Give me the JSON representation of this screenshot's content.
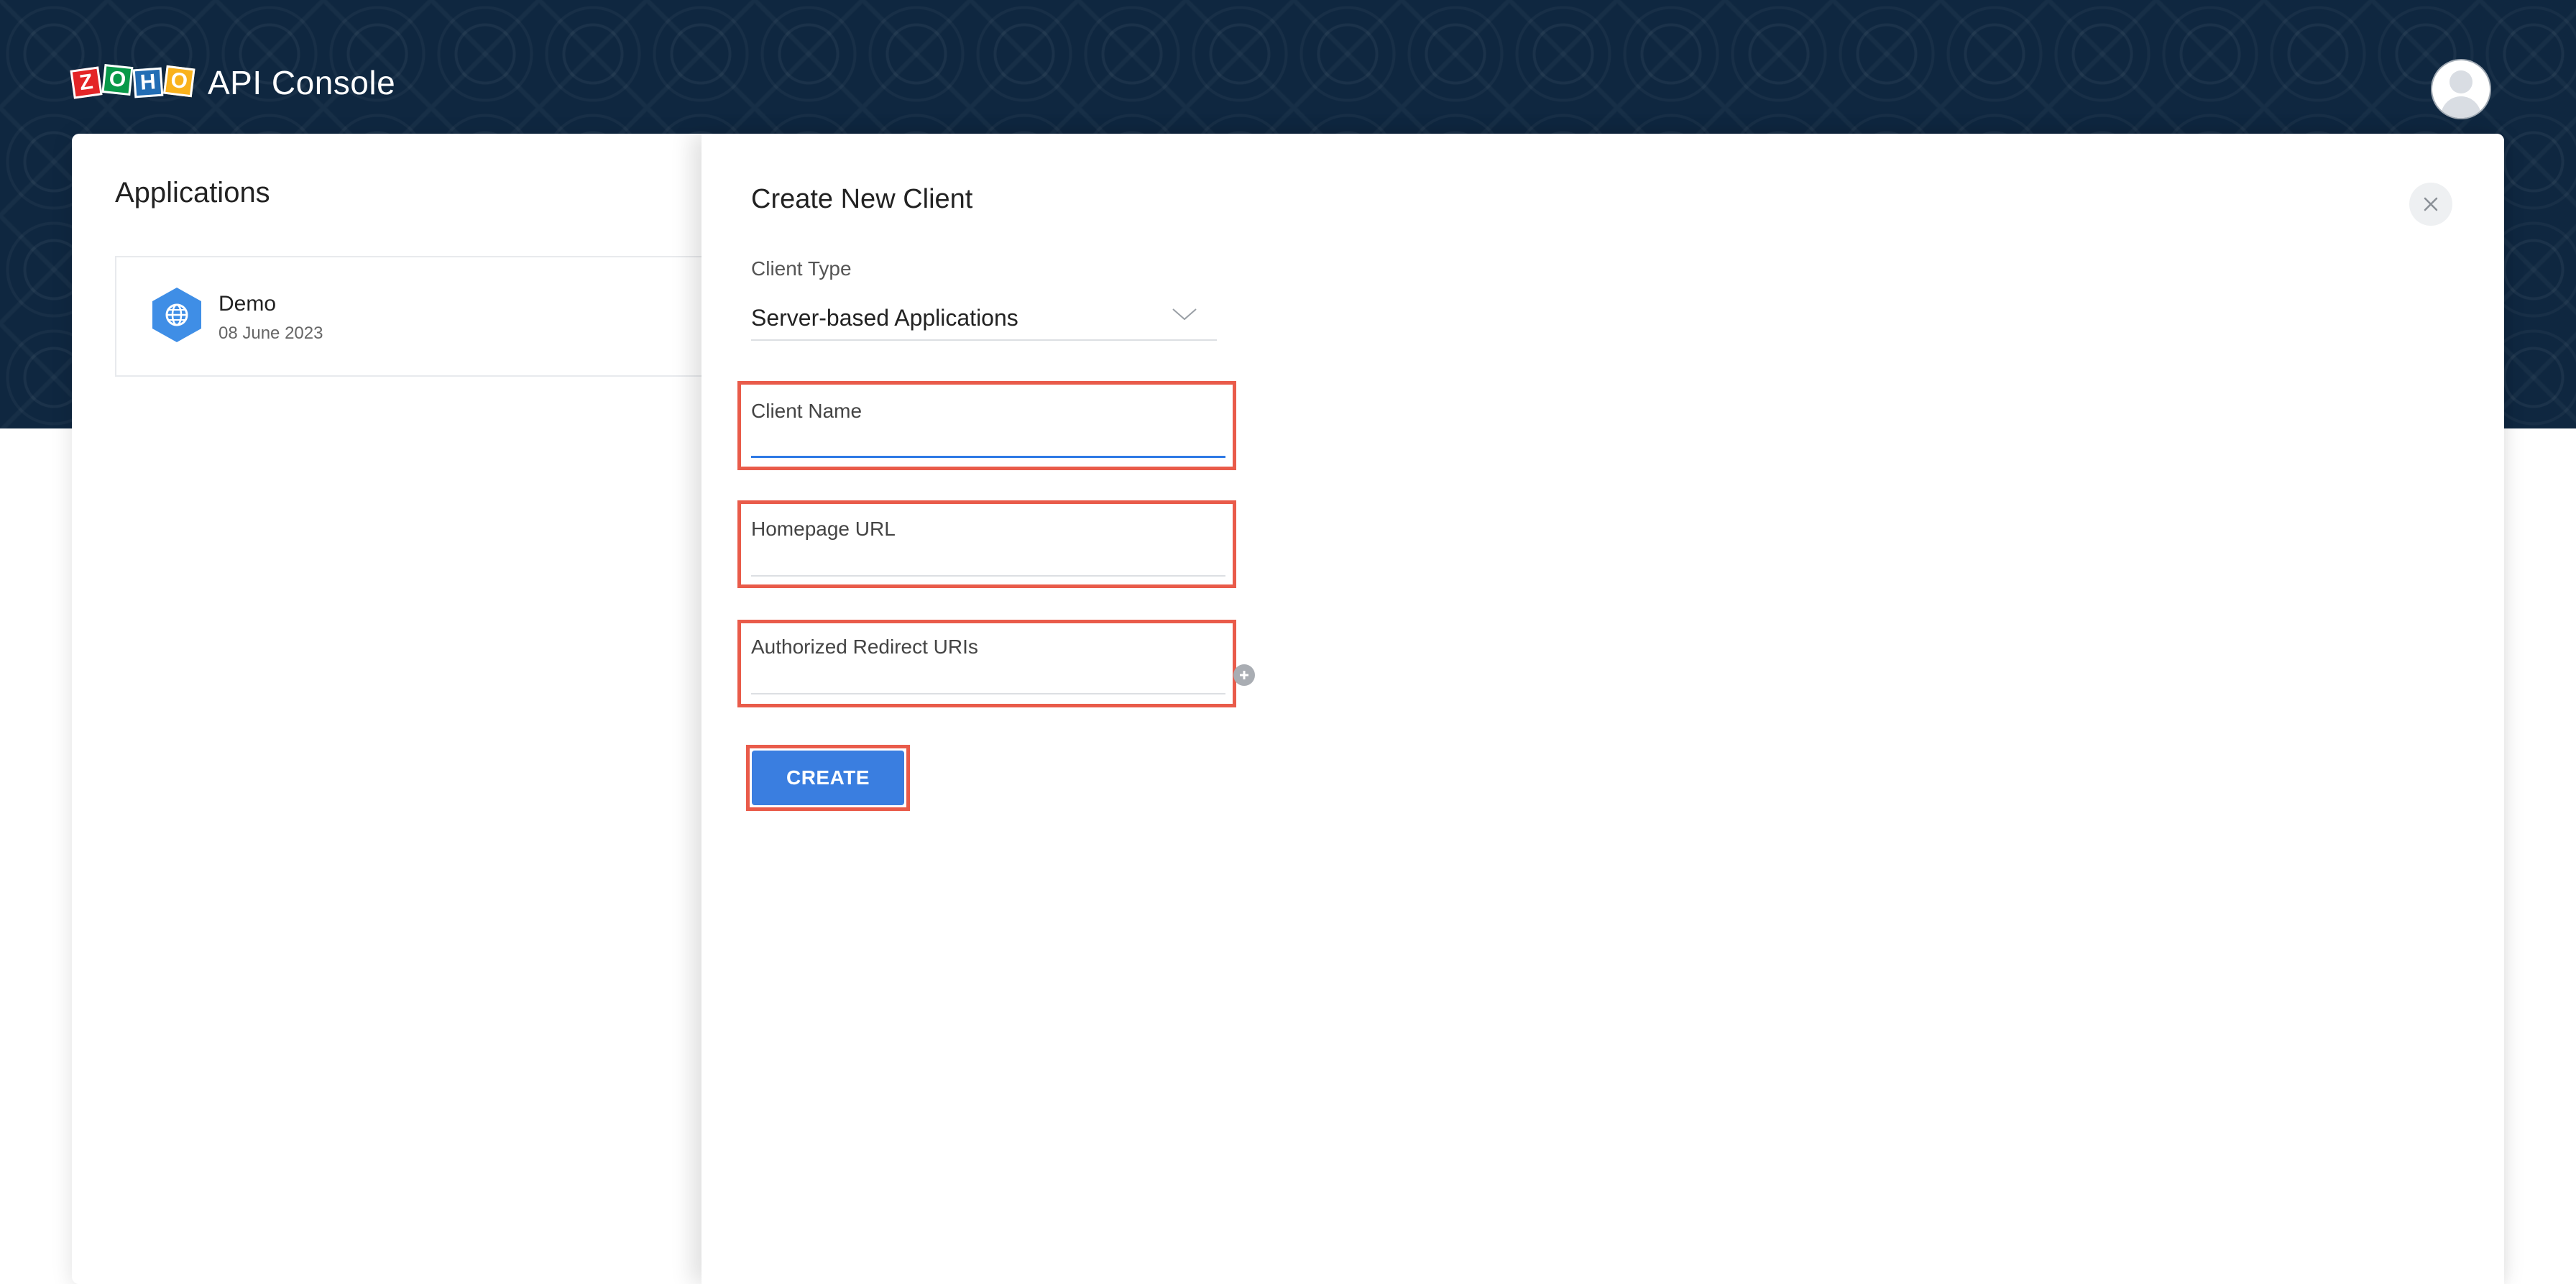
{
  "header": {
    "logo_letters": [
      "Z",
      "O",
      "H",
      "O"
    ],
    "app_title": "API Console",
    "logo_colors": [
      "#e42527",
      "#089949",
      "#226db4",
      "#f9b21d"
    ],
    "avatar_icon": "user-avatar-icon"
  },
  "applications": {
    "title": "Applications",
    "items": [
      {
        "name": "Demo",
        "date": "08 June 2023",
        "icon": "globe-icon"
      }
    ]
  },
  "create_client": {
    "title": "Create New Client",
    "close_icon": "close-icon",
    "client_type": {
      "label": "Client Type",
      "selected": "Server-based Applications"
    },
    "client_name": {
      "label": "Client Name",
      "value": ""
    },
    "homepage_url": {
      "label": "Homepage URL",
      "value": ""
    },
    "redirect_uris": {
      "label": "Authorized Redirect URIs",
      "value": "",
      "add_icon": "plus-icon"
    },
    "create_label": "CREATE"
  },
  "colors": {
    "header_bg": "#0f2740",
    "accent_blue": "#3a7ee0",
    "highlight_red": "#e95b4a"
  }
}
